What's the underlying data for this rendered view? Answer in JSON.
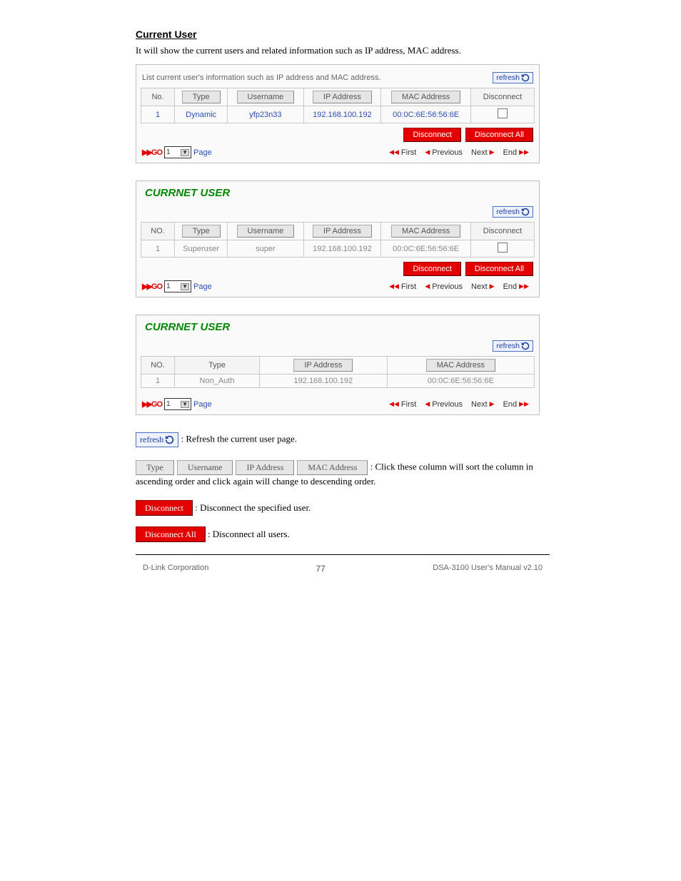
{
  "section_title": "Current User",
  "intro_text": "It will show the current users and related information such as IP address, MAC address.",
  "panel1": {
    "caption": "List current user's information such as IP address and MAC address.",
    "refresh_label": "refresh",
    "headers": {
      "no": "No.",
      "type": "Type",
      "username": "Username",
      "ip": "IP Address",
      "mac": "MAC Address",
      "disconnect": "Disconnect"
    },
    "row": {
      "no": "1",
      "type": "Dynamic",
      "username": "yfp23n33",
      "ip": "192.168.100.192",
      "mac": "00:0C:6E:56:56:6E"
    },
    "disconnect": "Disconnect",
    "disconnect_all": "Disconnect All",
    "pager": {
      "go": "GO",
      "page_no": "1",
      "page": "Page",
      "first": "First",
      "previous": "Previous",
      "next": "Next",
      "end": "End"
    }
  },
  "panel2": {
    "title": "CURRNET USER",
    "refresh_label": "refresh",
    "headers": {
      "no": "NO.",
      "type": "Type",
      "username": "Username",
      "ip": "IP Address",
      "mac": "MAC Address",
      "disconnect": "Disconnect"
    },
    "row": {
      "no": "1",
      "type": "Superuser",
      "username": "super",
      "ip": "192.168.100.192",
      "mac": "00:0C:6E:56:56:6E"
    },
    "disconnect": "Disconnect",
    "disconnect_all": "Disconnect All",
    "pager": {
      "go": "GO",
      "page_no": "1",
      "page": "Page",
      "first": "First",
      "previous": "Previous",
      "next": "Next",
      "end": "End"
    }
  },
  "panel3": {
    "title": "CURRNET USER",
    "refresh_label": "refresh",
    "headers": {
      "no": "NO.",
      "type": "Type",
      "ip": "IP Address",
      "mac": "MAC Address"
    },
    "row": {
      "no": "1",
      "type": "Non_Auth",
      "ip": "192.168.100.192",
      "mac": "00:0C:6E:56:56:6E"
    },
    "pager": {
      "go": "GO",
      "page_no": "1",
      "page": "Page",
      "first": "First",
      "previous": "Previous",
      "next": "Next",
      "end": "End"
    }
  },
  "legend": {
    "refresh": {
      "label": "refresh",
      "text": " : Refresh the current user page."
    },
    "sort": {
      "type": "Type",
      "username": "Username",
      "ip": "IP Address",
      "mac": "MAC Address",
      "text": " : Click these column will sort the column in ascending order and click again will change to descending order."
    },
    "disconnect": {
      "label": "Disconnect",
      "text": ": Disconnect the specified user."
    },
    "disconnect_all": {
      "label": "Disconnect All",
      "text": ": Disconnect all users."
    }
  },
  "footer": {
    "left": "D-Link Corporation",
    "center": "77",
    "right": "DSA-3100 User's Manual v2.10"
  },
  "colors": {
    "red": "#e20000",
    "blue": "#2a4db5",
    "green": "#008800"
  }
}
